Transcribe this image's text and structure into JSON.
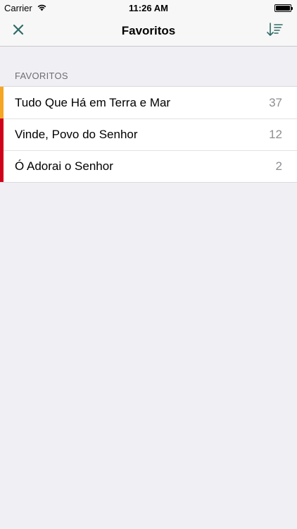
{
  "status_bar": {
    "carrier": "Carrier",
    "time": "11:26 AM",
    "wifi_icon": "wifi-icon",
    "battery_icon": "battery-icon"
  },
  "nav_bar": {
    "title": "Favoritos",
    "close_icon": "close-icon",
    "sort_icon": "sort-descending-icon",
    "accent_color": "#2e6b66"
  },
  "section": {
    "header": "FAVORITOS"
  },
  "items": [
    {
      "title": "Tudo Que Há em Terra e Mar",
      "count": "37",
      "color": "#f5a623"
    },
    {
      "title": "Vinde, Povo do Senhor",
      "count": "12",
      "color": "#d0021b"
    },
    {
      "title": "Ó Adorai o Senhor",
      "count": "2",
      "color": "#d0021b"
    }
  ]
}
